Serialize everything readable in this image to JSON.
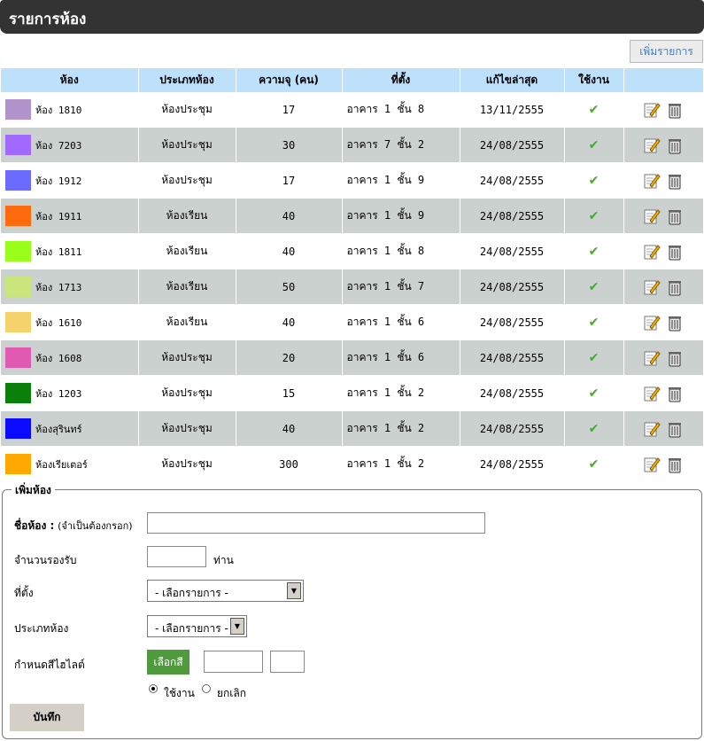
{
  "header": {
    "title": "รายการห้อง"
  },
  "toolbar": {
    "add_label": "เพิ่มรายการ"
  },
  "table": {
    "columns": [
      "ห้อง",
      "ประเภทห้อง",
      "ความจุ (คน)",
      "ที่ตั้ง",
      "แก้ไขล่าสุด",
      "ใช้งาน",
      ""
    ],
    "rows": [
      {
        "color": "#B294CC",
        "room": "ห้อง 1810",
        "type": "ห้องประชุม",
        "capacity": "17",
        "location": "อาคาร 1 ชั้น 8",
        "updated": "13/11/2555"
      },
      {
        "color": "#A269FF",
        "room": "ห้อง 7203",
        "type": "ห้องประชุม",
        "capacity": "30",
        "location": "อาคาร 7 ชั้น 2",
        "updated": "24/08/2555"
      },
      {
        "color": "#6B6BFF",
        "room": "ห้อง 1912",
        "type": "ห้องประชุม",
        "capacity": "17",
        "location": "อาคาร 1 ชั้น 9",
        "updated": "24/08/2555"
      },
      {
        "color": "#FF6A0E",
        "room": "ห้อง 1911",
        "type": "ห้องเรียน",
        "capacity": "40",
        "location": "อาคาร 1 ชั้น 9",
        "updated": "24/08/2555"
      },
      {
        "color": "#99FF1A",
        "room": "ห้อง 1811",
        "type": "ห้องเรียน",
        "capacity": "40",
        "location": "อาคาร 1 ชั้น 8",
        "updated": "24/08/2555"
      },
      {
        "color": "#C9E57C",
        "room": "ห้อง 1713",
        "type": "ห้องเรียน",
        "capacity": "50",
        "location": "อาคาร 1 ชั้น 7",
        "updated": "24/08/2555"
      },
      {
        "color": "#F5D26B",
        "room": "ห้อง 1610",
        "type": "ห้องเรียน",
        "capacity": "40",
        "location": "อาคาร 1 ชั้น 6",
        "updated": "24/08/2555"
      },
      {
        "color": "#E05AB2",
        "room": "ห้อง 1608",
        "type": "ห้องประชุม",
        "capacity": "20",
        "location": "อาคาร 1 ชั้น 6",
        "updated": "24/08/2555"
      },
      {
        "color": "#0A7F0A",
        "room": "ห้อง 1203",
        "type": "ห้องประชุม",
        "capacity": "15",
        "location": "อาคาร 1 ชั้น 2",
        "updated": "24/08/2555"
      },
      {
        "color": "#0A0AFF",
        "room": "ห้องสุรินทร์",
        "type": "ห้องประชุม",
        "capacity": "40",
        "location": "อาคาร 1 ชั้น 2",
        "updated": "24/08/2555"
      },
      {
        "color": "#FFA800",
        "room": "ห้องเรียเตอร์",
        "type": "ห้องประชุม",
        "capacity": "300",
        "location": "อาคาร 1 ชั้น 2",
        "updated": "24/08/2555"
      }
    ]
  },
  "form": {
    "legend": "เพิ่มห้อง",
    "name_label": "ชื่อห้อง :",
    "name_hint": "(จำเป็นต้องกรอก)",
    "name_value": "",
    "capacity_label": "จำนวนรองรับ",
    "capacity_value": "",
    "capacity_unit": "ท่าน",
    "location_label": "ที่ตั้ง",
    "location_selected": "- เลือกรายการ -",
    "type_label": "ประเภทห้อง",
    "type_selected": "- เลือกรายการ -",
    "color_label": "กำหนดสีไฮไลต์",
    "color_button": "เลือกสี",
    "status_active": "ใช้งาน",
    "status_cancel": "ยกเลิก",
    "save_label": "บันทึก"
  }
}
